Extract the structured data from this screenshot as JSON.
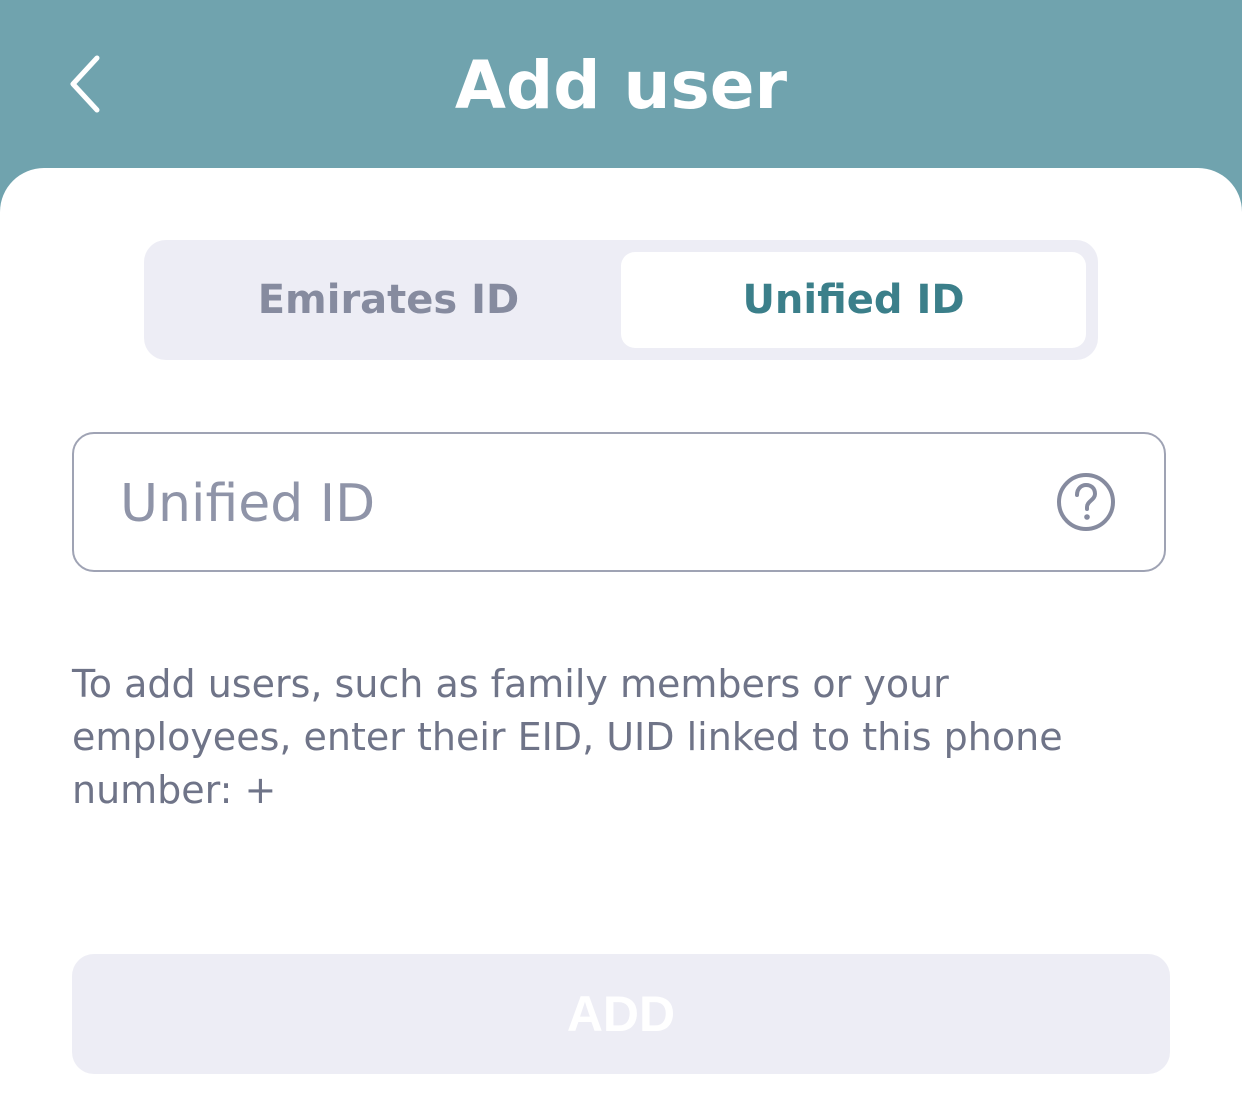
{
  "header": {
    "title": "Add user",
    "back_icon": "chevron-left-icon"
  },
  "id_type_tabs": [
    {
      "label": "Emirates ID",
      "selected": false
    },
    {
      "label": "Unified ID",
      "selected": true
    }
  ],
  "unified_id_field": {
    "placeholder": "Unified ID",
    "value": "",
    "help_icon": "question-circle-icon"
  },
  "hint_text": "To add users, such as family members or your employees, enter their EID, UID linked to this phone number: +",
  "add_button": {
    "label": "ADD",
    "enabled": false
  },
  "colors": {
    "header_bg": "#70a3ae",
    "accent": "#3b7f8a",
    "segmented_bg": "#ededf5",
    "muted_text": "#6f7488"
  }
}
